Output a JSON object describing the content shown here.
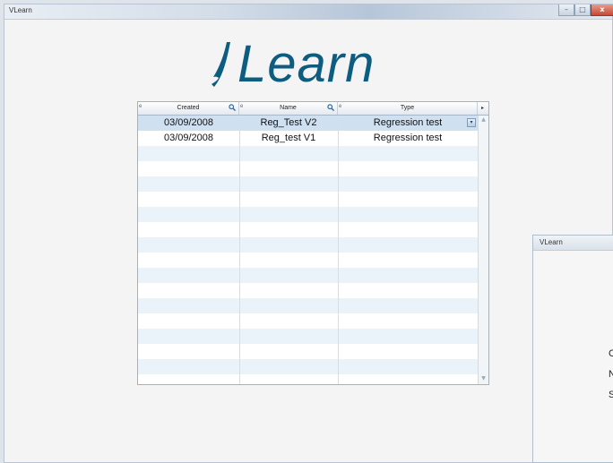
{
  "window": {
    "title": "VLearn",
    "buttons": {
      "minimize": "–",
      "maximize": "□",
      "close": "x"
    }
  },
  "logo": {
    "text": "Learn"
  },
  "table": {
    "columns": [
      {
        "label": "Created",
        "sort_glyph": "e",
        "has_search": true
      },
      {
        "label": "Name",
        "sort_glyph": "e",
        "has_search": true
      },
      {
        "label": "Type",
        "sort_glyph": "e",
        "has_search": false
      }
    ],
    "menu_glyph": "▸",
    "rows": [
      {
        "created": "03/09/2008",
        "name": "Reg_Test V2",
        "type": "Regression test",
        "selected": true
      },
      {
        "created": "03/09/2008",
        "name": "Reg_test V1",
        "type": "Regression test",
        "selected": false
      }
    ],
    "dropdown_glyph": "▾",
    "scroll_up": "▲",
    "scroll_down": "▼"
  },
  "second_window": {
    "title": "VLearn",
    "partial_letters": [
      "C",
      "N",
      "S"
    ]
  },
  "colors": {
    "logo": "#0d5d80",
    "row_alt": "#eaf2fa",
    "row_selected": "#cfe0f1",
    "border": "#9fb3c8"
  }
}
